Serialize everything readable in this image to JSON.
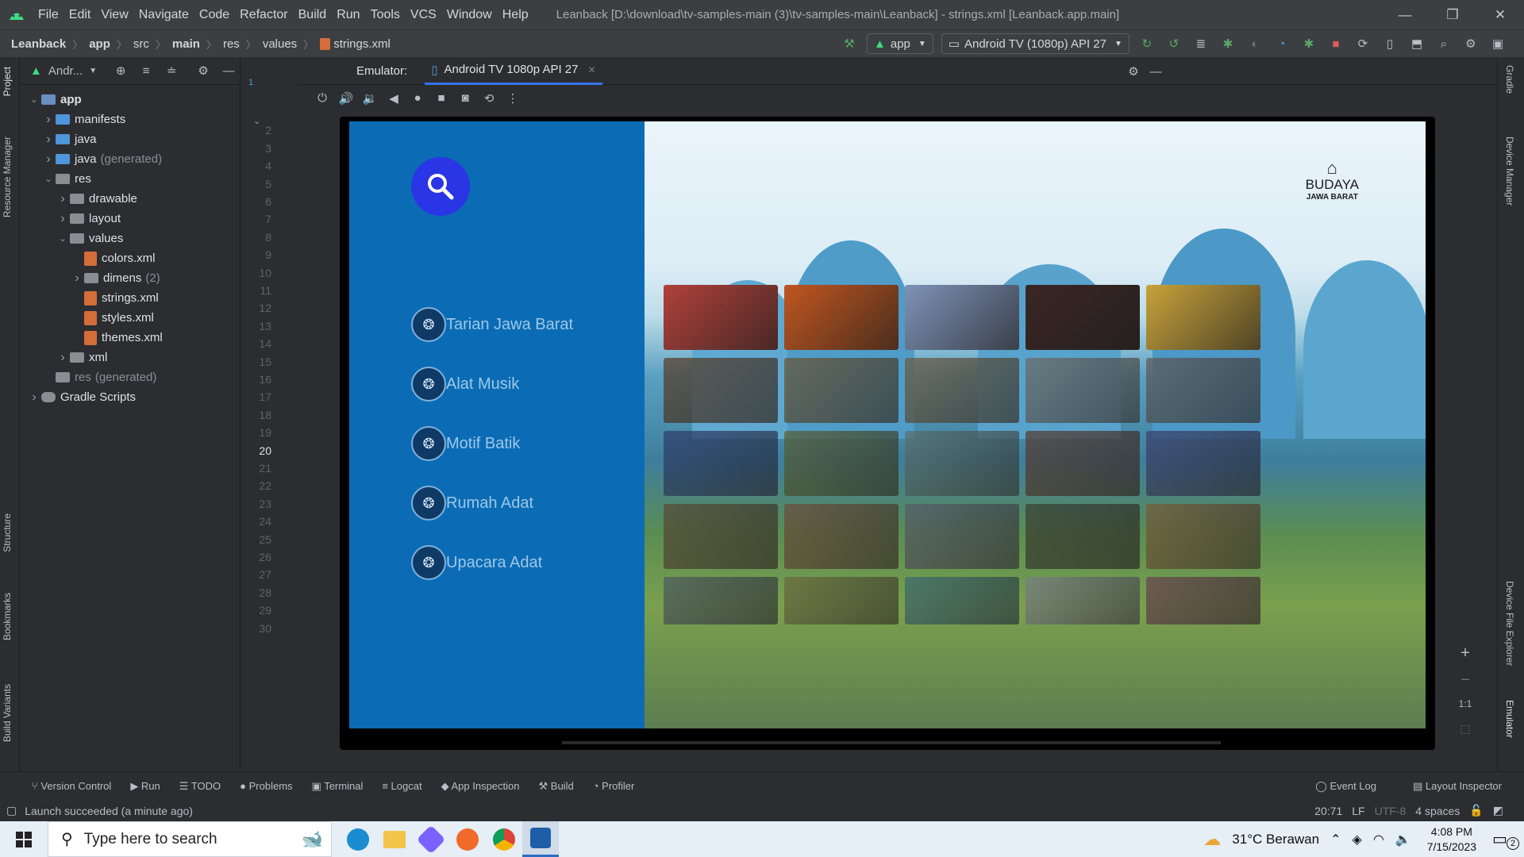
{
  "titlebar": {
    "menu": [
      "File",
      "Edit",
      "View",
      "Navigate",
      "Code",
      "Refactor",
      "Build",
      "Run",
      "Tools",
      "VCS",
      "Window",
      "Help"
    ],
    "title": "Leanback [D:\\download\\tv-samples-main (3)\\tv-samples-main\\Leanback] - strings.xml [Leanback.app.main]"
  },
  "navbar": {
    "crumbs": [
      "Leanback",
      "app",
      "src",
      "main",
      "res",
      "values"
    ],
    "file": "strings.xml",
    "run_config": "app",
    "device": "Android TV (1080p) API 27"
  },
  "project": {
    "header": "Andr...",
    "tree": [
      {
        "label": "app",
        "level": 0,
        "expanded": true,
        "type": "module"
      },
      {
        "label": "manifests",
        "level": 1,
        "expanded": false,
        "type": "folder"
      },
      {
        "label": "java",
        "level": 1,
        "expanded": false,
        "type": "folder"
      },
      {
        "label": "java",
        "suffix": "(generated)",
        "level": 1,
        "expanded": false,
        "type": "folder"
      },
      {
        "label": "res",
        "level": 1,
        "expanded": true,
        "type": "folder-gray"
      },
      {
        "label": "drawable",
        "level": 2,
        "expanded": false,
        "type": "folder-gray"
      },
      {
        "label": "layout",
        "level": 2,
        "expanded": false,
        "type": "folder-gray"
      },
      {
        "label": "values",
        "level": 2,
        "expanded": true,
        "type": "folder-gray"
      },
      {
        "label": "colors.xml",
        "level": 3,
        "type": "xml"
      },
      {
        "label": "dimens",
        "suffix": "(2)",
        "level": 3,
        "expanded": false,
        "type": "folder-gray"
      },
      {
        "label": "strings.xml",
        "level": 3,
        "type": "xml"
      },
      {
        "label": "styles.xml",
        "level": 3,
        "type": "xml"
      },
      {
        "label": "themes.xml",
        "level": 3,
        "type": "xml"
      },
      {
        "label": "xml",
        "level": 2,
        "expanded": false,
        "type": "folder-gray"
      },
      {
        "label": "res",
        "suffix": "(generated)",
        "level": 1,
        "type": "folder-gray",
        "dim": true
      },
      {
        "label": "Gradle Scripts",
        "level": 0,
        "expanded": false,
        "type": "gradle"
      }
    ]
  },
  "left_tabs": [
    "Project",
    "Resource Manager",
    "Structure",
    "Bookmarks",
    "Build Variants"
  ],
  "right_tabs": [
    "Gradle",
    "Device Manager",
    "Device File Explorer",
    "Emulator"
  ],
  "gutter": {
    "lines": [
      "1",
      "2",
      "3",
      "4",
      "5",
      "6",
      "7",
      "8",
      "9",
      "10",
      "11",
      "12",
      "13",
      "14",
      "15",
      "16",
      "17",
      "18",
      "19",
      "20",
      "21",
      "22",
      "23",
      "24",
      "25",
      "26",
      "27",
      "28",
      "29",
      "30"
    ],
    "current": "20"
  },
  "emulator": {
    "label": "Emulator:",
    "tab": "Android TV 1080p API 27",
    "zoom_label": "1:1"
  },
  "tv_app": {
    "categories": [
      "Tarian Jawa Barat",
      "Alat Musik",
      "Motif Batik",
      "Rumah Adat",
      "Upacara Adat"
    ],
    "logo_line1": "BUDAYA",
    "logo_line2": "JAWA BARAT",
    "card_colors": [
      [
        "#b0413a",
        "#c0561f",
        "#7f93b8",
        "#3a2624",
        "#c8a23a"
      ],
      [
        "#5a3a22",
        "#6b5530",
        "#6e5a3c",
        "#6f6a62",
        "#5f5954"
      ],
      [
        "#2e3d6b",
        "#5a5e2e",
        "#5b6f6b",
        "#5a3a2c",
        "#3c3f6a"
      ],
      [
        "#5a4a35",
        "#6e4e3a",
        "#5a5d6a",
        "#3c3f32",
        "#7a5a38"
      ],
      [
        "#4e5a60",
        "#6a6a40",
        "#3c6a72",
        "#7c8088",
        "#6a4050"
      ]
    ]
  },
  "toolwindows": [
    "Version Control",
    "Run",
    "TODO",
    "Problems",
    "Terminal",
    "Logcat",
    "App Inspection",
    "Build",
    "Profiler"
  ],
  "toolwindows_right": [
    "Event Log",
    "Layout Inspector"
  ],
  "status": {
    "message": "Launch succeeded (a minute ago)",
    "position": "20:71",
    "line_sep": "LF",
    "encoding": "UTF-8",
    "indent": "4 spaces"
  },
  "taskbar": {
    "search_placeholder": "Type here to search",
    "weather": "31°C  Berawan",
    "time": "4:08 PM",
    "date": "7/15/2023",
    "notif_count": "2"
  }
}
